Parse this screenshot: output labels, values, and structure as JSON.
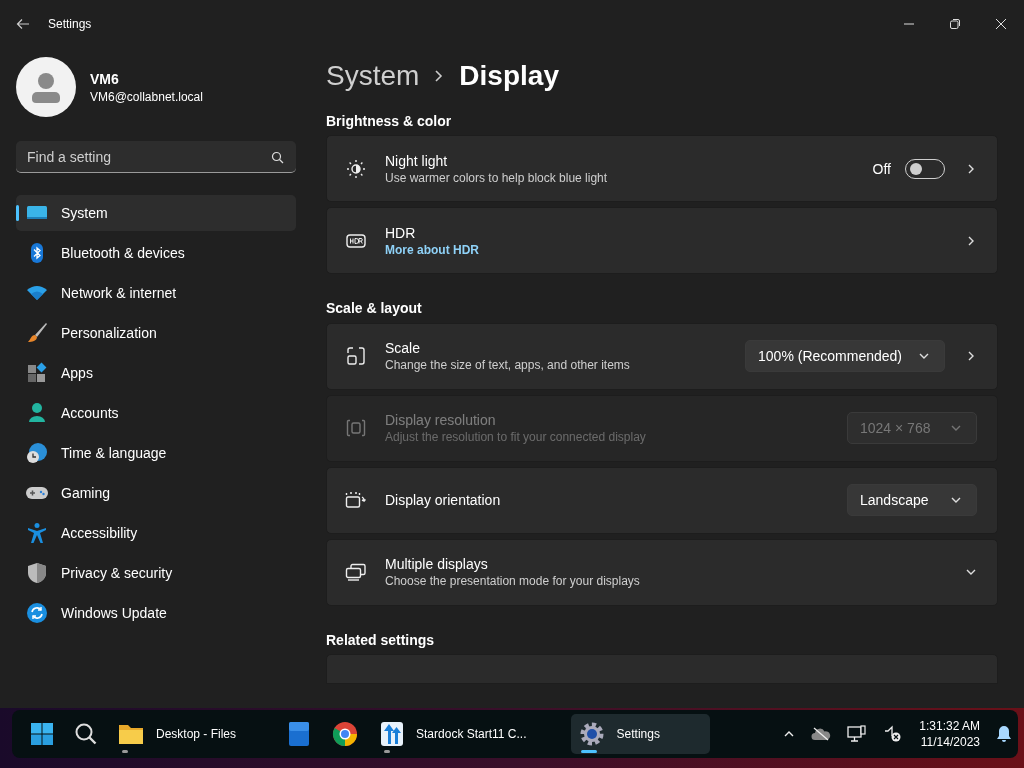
{
  "window": {
    "title": "Settings"
  },
  "account": {
    "name": "VM6",
    "email": "VM6@collabnet.local"
  },
  "search": {
    "placeholder": "Find a setting"
  },
  "nav": [
    {
      "label": "System",
      "selected": true
    },
    {
      "label": "Bluetooth & devices",
      "selected": false
    },
    {
      "label": "Network & internet",
      "selected": false
    },
    {
      "label": "Personalization",
      "selected": false
    },
    {
      "label": "Apps",
      "selected": false
    },
    {
      "label": "Accounts",
      "selected": false
    },
    {
      "label": "Time & language",
      "selected": false
    },
    {
      "label": "Gaming",
      "selected": false
    },
    {
      "label": "Accessibility",
      "selected": false
    },
    {
      "label": "Privacy & security",
      "selected": false
    },
    {
      "label": "Windows Update",
      "selected": false
    }
  ],
  "breadcrumb": {
    "parent": "System",
    "current": "Display"
  },
  "sections": [
    {
      "title": "Brightness & color",
      "cards": [
        {
          "kind": "toggle",
          "title": "Night light",
          "description": "Use warmer colors to help block blue light",
          "state_label": "Off",
          "on": false,
          "disabled": false
        },
        {
          "kind": "link",
          "title": "HDR",
          "link": "More about HDR",
          "disabled": false
        }
      ]
    },
    {
      "title": "Scale & layout",
      "cards": [
        {
          "kind": "dropdown",
          "title": "Scale",
          "description": "Change the size of text, apps, and other items",
          "value": "100% (Recommended)",
          "navigates": true,
          "disabled": false
        },
        {
          "kind": "dropdown",
          "title": "Display resolution",
          "description": "Adjust the resolution to fit your connected display",
          "value": "1024 × 768",
          "navigates": false,
          "disabled": true
        },
        {
          "kind": "dropdown",
          "title": "Display orientation",
          "value": "Landscape",
          "navigates": false,
          "disabled": false
        },
        {
          "kind": "expander",
          "title": "Multiple displays",
          "description": "Choose the presentation mode for your displays",
          "expanded": false,
          "disabled": false
        }
      ]
    },
    {
      "title": "Related settings",
      "cards": [
        {
          "kind": "cut"
        }
      ]
    }
  ],
  "taskbar": {
    "apps": [
      {
        "label": "Desktop - Files",
        "running": true,
        "selected": false
      },
      {
        "running": false,
        "selected": false
      },
      {
        "running": false,
        "selected": false
      },
      {
        "label": "Stardock Start11 C...",
        "running": true,
        "selected": false
      },
      {
        "label": "Settings",
        "running": true,
        "selected": true
      }
    ],
    "time": "1:31:32 AM",
    "date": "11/14/2023"
  }
}
